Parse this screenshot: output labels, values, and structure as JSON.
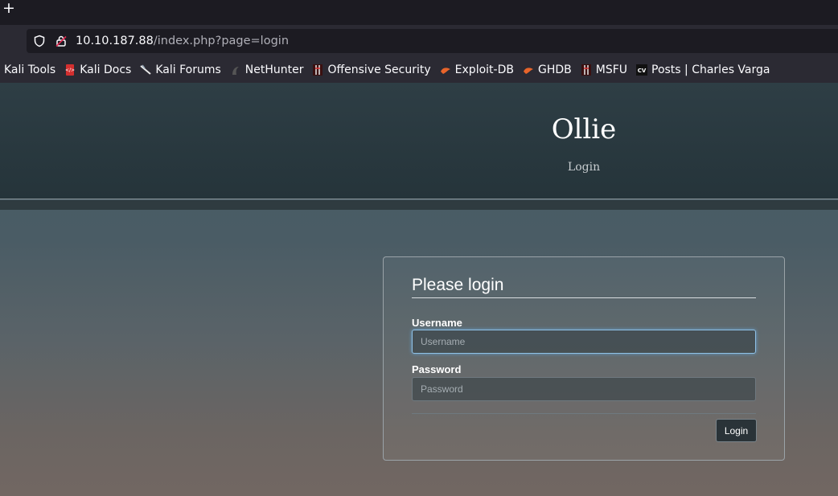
{
  "browser": {
    "url_host": "10.10.187.88",
    "url_path": "/index.php?page=login",
    "bookmarks": [
      {
        "label": "Kali Tools",
        "icon": "none"
      },
      {
        "label": "Kali Docs",
        "icon": "kali-docs-icon"
      },
      {
        "label": "Kali Forums",
        "icon": "kali-forums-icon"
      },
      {
        "label": "NetHunter",
        "icon": "nethunter-icon"
      },
      {
        "label": "Offensive Security",
        "icon": "offsec-icon"
      },
      {
        "label": "Exploit-DB",
        "icon": "exploit-db-icon"
      },
      {
        "label": "GHDB",
        "icon": "ghdb-icon"
      },
      {
        "label": "MSFU",
        "icon": "msfu-icon"
      },
      {
        "label": "Posts | Charles Varga",
        "icon": "cv-icon"
      }
    ]
  },
  "site": {
    "title": "Ollie",
    "nav_login": "Login"
  },
  "login_form": {
    "legend": "Please login",
    "username_label": "Username",
    "username_placeholder": "Username",
    "password_label": "Password",
    "password_placeholder": "Password",
    "submit_label": "Login"
  },
  "colors": {
    "focus_ring": "#66afe9",
    "header_bg": "#25343a",
    "kali_docs_red": "#d32f2f",
    "exploit_orange": "#e8642a"
  }
}
